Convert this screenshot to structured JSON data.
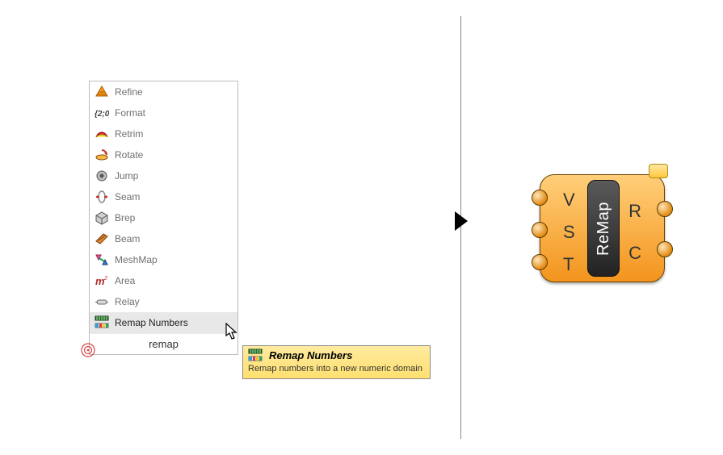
{
  "search": {
    "value": "remap",
    "items": [
      {
        "label": "Refine",
        "icon": "refine-icon"
      },
      {
        "label": "Format",
        "icon": "format-icon"
      },
      {
        "label": "Retrim",
        "icon": "retrim-icon"
      },
      {
        "label": "Rotate",
        "icon": "rotate-icon"
      },
      {
        "label": "Jump",
        "icon": "jump-icon"
      },
      {
        "label": "Seam",
        "icon": "seam-icon"
      },
      {
        "label": "Brep",
        "icon": "brep-icon"
      },
      {
        "label": "Beam",
        "icon": "beam-icon"
      },
      {
        "label": "MeshMap",
        "icon": "meshmap-icon"
      },
      {
        "label": "Area",
        "icon": "area-icon"
      },
      {
        "label": "Relay",
        "icon": "relay-icon"
      },
      {
        "label": "Remap Numbers",
        "icon": "remap-icon",
        "selected": true
      }
    ]
  },
  "tooltip": {
    "title": "Remap Numbers",
    "desc": "Remap numbers into a new numeric domain"
  },
  "component": {
    "name": "ReMap",
    "inputs": [
      "V",
      "S",
      "T"
    ],
    "outputs": [
      "R",
      "C"
    ]
  }
}
